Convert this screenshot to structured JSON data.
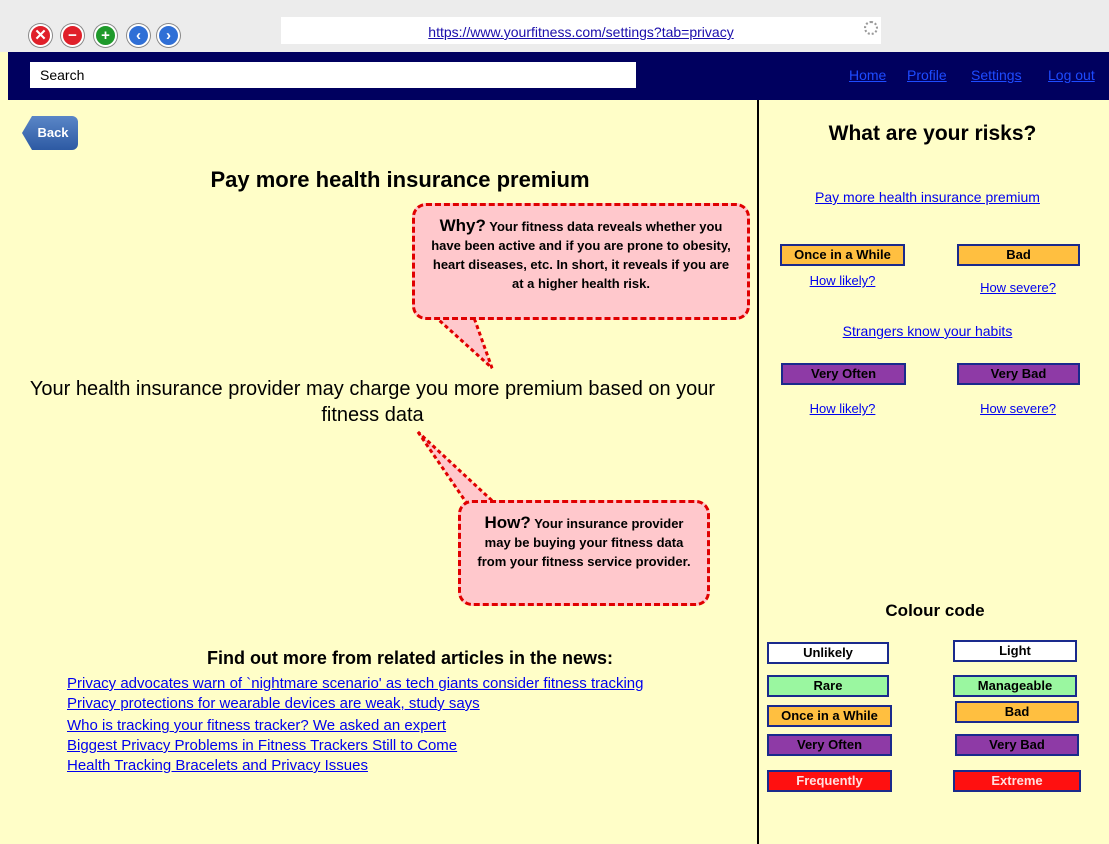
{
  "browser": {
    "url": "https://www.yourfitness.com/settings?tab=privacy",
    "buttons": [
      {
        "name": "close-icon",
        "glyph": "✕",
        "color": "#e0202a"
      },
      {
        "name": "minus-icon",
        "glyph": "−",
        "color": "#e0202a"
      },
      {
        "name": "plus-icon",
        "glyph": "+",
        "color": "#1f9a2b"
      },
      {
        "name": "back-arrow-icon",
        "glyph": "‹",
        "color": "#2f6fd6"
      },
      {
        "name": "forward-arrow-icon",
        "glyph": "›",
        "color": "#2f6fd6"
      }
    ]
  },
  "nav": {
    "search_placeholder": "Search",
    "links": [
      "Home",
      "Profile",
      "Settings",
      "Log out"
    ]
  },
  "main": {
    "back_label": "Back",
    "title": "Pay more health insurance premium",
    "why": {
      "lead": "Why?",
      "text": "Your fitness data reveals whether you have been active and if you are prone to obesity, heart diseases, etc. In short, it reveals if you are at a higher health risk."
    },
    "statement": "Your health insurance provider may charge you more premium based on your fitness data",
    "how": {
      "lead": "How?",
      "text": "Your insurance provider may be buying your fitness data from your fitness service provider."
    },
    "articles_heading": "Find out more from related articles in the news:",
    "articles": [
      "Privacy advocates warn of `nightmare scenario' as tech giants consider fitness tracking",
      "Privacy protections for wearable devices are weak, study says",
      "Who is tracking your fitness tracker? We asked an expert",
      "Biggest Privacy Problems in Fitness Trackers Still to Come",
      "Health Tracking Bracelets and Privacy Issues"
    ]
  },
  "sidebar": {
    "title": "What are your risks?",
    "risks": [
      {
        "title": "Pay more health insurance premium",
        "likelihood": {
          "label": "Once in a While",
          "color": "#ffbf40"
        },
        "severity": {
          "label": "Bad",
          "color": "#ffbf40"
        },
        "how_likely": "How likely?",
        "how_severe": "How severe?"
      },
      {
        "title": "Strangers know your habits",
        "likelihood": {
          "label": "Very Often",
          "color": "#8e3aa6"
        },
        "severity": {
          "label": "Very Bad",
          "color": "#8e3aa6"
        },
        "how_likely": "How likely?",
        "how_severe": "How severe?"
      }
    ],
    "colour_code": {
      "title": "Colour code",
      "likelihood": [
        {
          "label": "Unlikely",
          "color": "#ffffff"
        },
        {
          "label": "Rare",
          "color": "#9af7a0"
        },
        {
          "label": "Once in a While",
          "color": "#ffbf40"
        },
        {
          "label": "Very Often",
          "color": "#8e3aa6"
        },
        {
          "label": "Frequently",
          "color": "#ff1010"
        }
      ],
      "severity": [
        {
          "label": "Light",
          "color": "#ffffff"
        },
        {
          "label": "Manageable",
          "color": "#9af7a0"
        },
        {
          "label": "Bad",
          "color": "#ffbf40"
        },
        {
          "label": "Very Bad",
          "color": "#8e3aa6"
        },
        {
          "label": "Extreme",
          "color": "#ff1010"
        }
      ]
    }
  }
}
